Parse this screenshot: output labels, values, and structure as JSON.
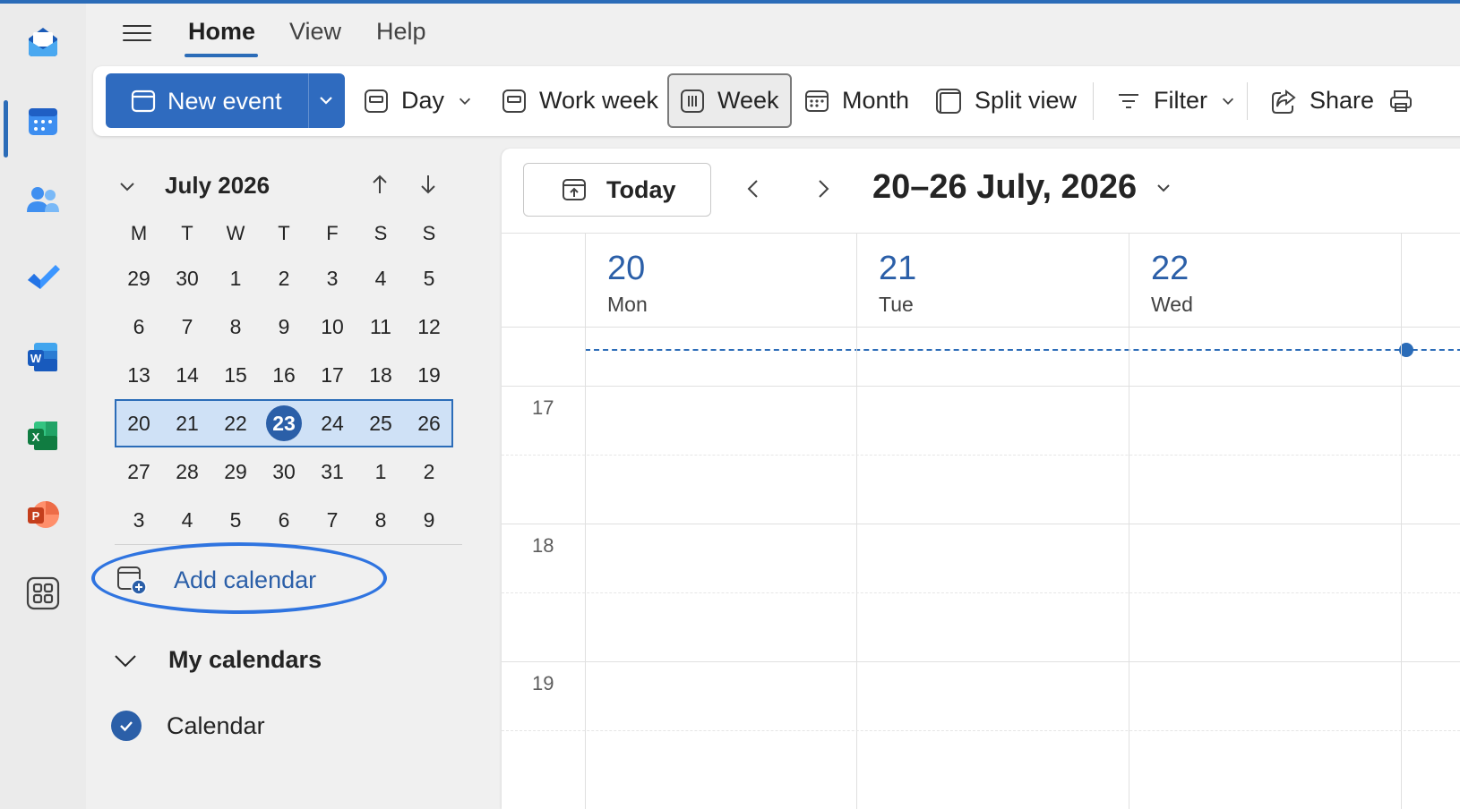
{
  "tabs": {
    "home": "Home",
    "view": "View",
    "help": "Help"
  },
  "ribbon": {
    "new_event": "New event",
    "day": "Day",
    "work_week": "Work week",
    "week": "Week",
    "month": "Month",
    "split_view": "Split view",
    "filter": "Filter",
    "share": "Share"
  },
  "mini_calendar": {
    "title": "July 2026",
    "weekdays": [
      "M",
      "T",
      "W",
      "T",
      "F",
      "S",
      "S"
    ],
    "weeks": [
      [
        "29",
        "30",
        "1",
        "2",
        "3",
        "4",
        "5"
      ],
      [
        "6",
        "7",
        "8",
        "9",
        "10",
        "11",
        "12"
      ],
      [
        "13",
        "14",
        "15",
        "16",
        "17",
        "18",
        "19"
      ],
      [
        "20",
        "21",
        "22",
        "23",
        "24",
        "25",
        "26"
      ],
      [
        "27",
        "28",
        "29",
        "30",
        "31",
        "1",
        "2"
      ],
      [
        "3",
        "4",
        "5",
        "6",
        "7",
        "8",
        "9"
      ]
    ],
    "selected_week_index": 3,
    "today": "23"
  },
  "left_pane": {
    "add_calendar": "Add calendar",
    "my_calendars": "My calendars",
    "calendar_item": "Calendar"
  },
  "calendar": {
    "today_button": "Today",
    "range_title": "20–26 July, 2026",
    "days": [
      {
        "num": "20",
        "name": "Mon"
      },
      {
        "num": "21",
        "name": "Tue"
      },
      {
        "num": "22",
        "name": "Wed"
      }
    ],
    "hours": [
      "17",
      "18",
      "19"
    ]
  },
  "colors": {
    "accent": "#2b6cb8",
    "selected_week": "#cfe1f6",
    "brand_button": "#2f6bbf"
  }
}
